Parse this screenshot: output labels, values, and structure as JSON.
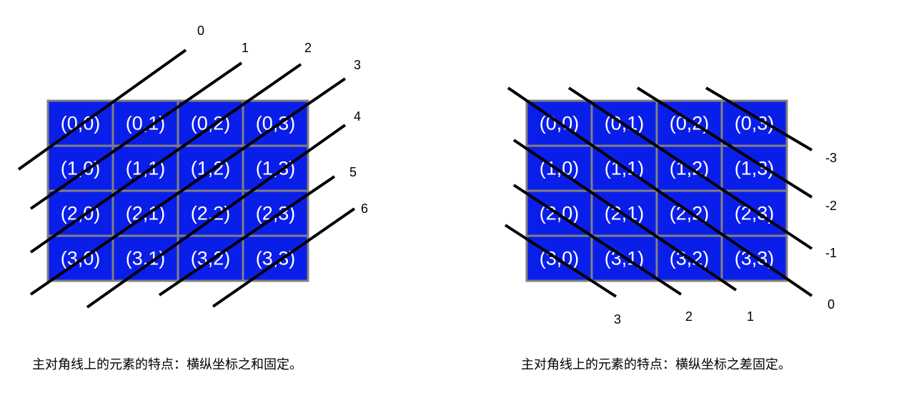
{
  "cells": [
    [
      "(0,0)",
      "(0,1)",
      "(0,2)",
      "(0,3)"
    ],
    [
      "(1,0)",
      "(1,1)",
      "(1,2)",
      "(1,3)"
    ],
    [
      "(2,0)",
      "(2,1)",
      "(2,2)",
      "(2,3)"
    ],
    [
      "(3,0)",
      "(3,1)",
      "(3,2)",
      "(3,3)"
    ]
  ],
  "left_diagram": {
    "line_labels": [
      "0",
      "1",
      "2",
      "3",
      "4",
      "5",
      "6"
    ],
    "caption": "主对角线上的元素的特点：横纵坐标之和固定。"
  },
  "right_diagram": {
    "line_labels": [
      "-3",
      "-2",
      "-1",
      "0",
      "1",
      "2",
      "3"
    ],
    "caption": "主对角线上的元素的特点：横纵坐标之差固定。"
  },
  "colors": {
    "cell_fill": "#0a1eea",
    "cell_border": "#808080",
    "cell_text": "#ffffff",
    "line": "#000000"
  }
}
